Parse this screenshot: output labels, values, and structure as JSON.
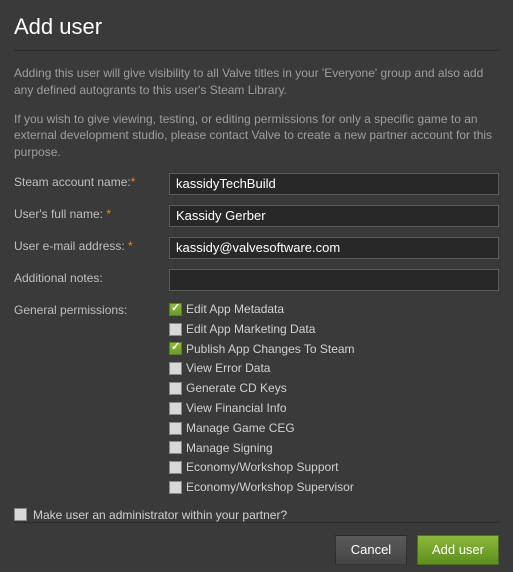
{
  "title": "Add user",
  "intro1": "Adding this user will give visibility to all Valve titles in your 'Everyone' group and also add any defined autogrants to this user's Steam Library.",
  "intro2": "If you wish to give viewing, testing, or editing permissions for only a specific game to an external development studio, please contact Valve to create a new partner account for this purpose.",
  "labels": {
    "account": "Steam account name:",
    "fullname": "User's full name: ",
    "email": "User e-mail address: ",
    "notes": "Additional notes:",
    "perms": "General permissions:"
  },
  "required_mark": "*",
  "values": {
    "account": "kassidyTechBuild",
    "fullname": "Kassidy Gerber",
    "email": "kassidy@valvesoftware.com",
    "notes": ""
  },
  "permissions": [
    {
      "label": "Edit App Metadata",
      "checked": true
    },
    {
      "label": "Edit App Marketing Data",
      "checked": false
    },
    {
      "label": "Publish App Changes To Steam",
      "checked": true
    },
    {
      "label": "View Error Data",
      "checked": false
    },
    {
      "label": "Generate CD Keys",
      "checked": false
    },
    {
      "label": "View Financial Info",
      "checked": false
    },
    {
      "label": "Manage Game CEG",
      "checked": false
    },
    {
      "label": "Manage Signing",
      "checked": false
    },
    {
      "label": "Economy/Workshop Support",
      "checked": false
    },
    {
      "label": "Economy/Workshop Supervisor",
      "checked": false
    }
  ],
  "admin": {
    "label": "Make user an administrator within your partner?",
    "checked": false
  },
  "buttons": {
    "cancel": "Cancel",
    "submit": "Add user"
  }
}
